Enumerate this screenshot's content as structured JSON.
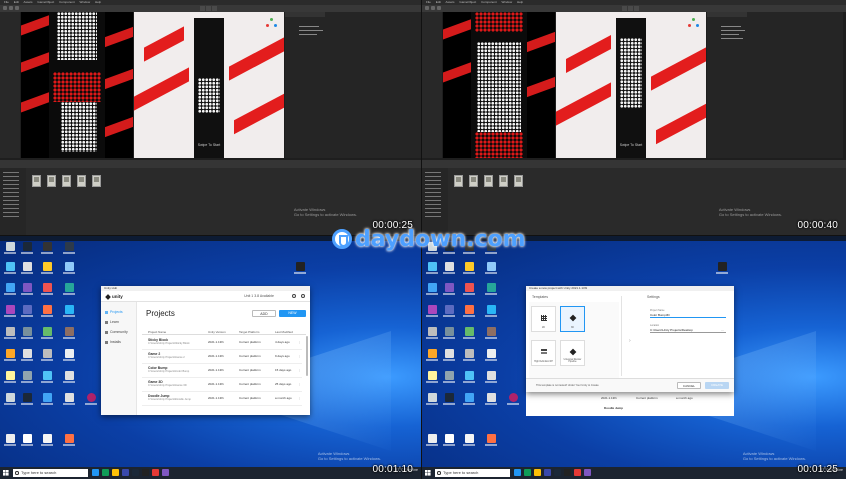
{
  "quadrants": {
    "top_left": {
      "timestamp": "00:00:25",
      "scene_text": "Swipe To Start",
      "menu": [
        "File",
        "Edit",
        "Assets",
        "GameObject",
        "Component",
        "Window",
        "Help"
      ],
      "activate": [
        "Activate Windows",
        "Go to Settings to activate Windows."
      ]
    },
    "top_right": {
      "timestamp": "00:00:40",
      "scene_text": "Swipe To Start",
      "menu": [
        "File",
        "Edit",
        "Assets",
        "GameObject",
        "Component",
        "Window",
        "Help"
      ],
      "activate": [
        "Activate Windows",
        "Go to Settings to activate Windows."
      ]
    },
    "bottom_left": {
      "timestamp": "00:01:10",
      "search_placeholder": "Type here to search",
      "tray_text": "17°C Esterline",
      "activate": [
        "Activate Windows",
        "Go to Settings to activate Windows."
      ],
      "hub": {
        "window_title": "Unity Hub",
        "logo": "unity",
        "license": "Unit 1 3.8 Available",
        "nav": [
          "Projects",
          "Learn",
          "Community",
          "Installs"
        ],
        "title": "Projects",
        "add_label": "ADD",
        "new_label": "NEW",
        "columns": [
          "Project Name",
          "Unity Version",
          "Target Platform",
          "Last Modified"
        ],
        "rows": [
          {
            "name": "Sticky Block",
            "path": "C:\\Users\\Unity Projects\\Sticky Block",
            "version": "2021.1.13f1",
            "platform": "Current platform",
            "modified": "4 days ago"
          },
          {
            "name": "Game 2",
            "path": "C:\\Users\\Unity Projects\\Game 2",
            "version": "2021.1.13f1",
            "platform": "Current platform",
            "modified": "9 days ago"
          },
          {
            "name": "Color Bump",
            "path": "C:\\Users\\Unity Projects\\Color Bump",
            "version": "2021.1.13f1",
            "platform": "Current platform",
            "modified": "15 days ago"
          },
          {
            "name": "Game 3D",
            "path": "C:\\Users\\Unity Projects\\Game 3D",
            "version": "2021.1.13f1",
            "platform": "Current platform",
            "modified": "25 days ago"
          },
          {
            "name": "Doodle Jump",
            "path": "C:\\Users\\Unity Projects\\Doodle Jump",
            "version": "2021.1.13f1",
            "platform": "Current platform",
            "modified": "a month ago"
          }
        ]
      }
    },
    "bottom_right": {
      "timestamp": "00:01:25",
      "search_placeholder": "Type here to search",
      "tray_text": "17°C Esterline",
      "activate": [
        "Activate Windows",
        "Go to Settings to activate Windows."
      ],
      "new_project": {
        "window_title": "Create a new project with Unity 2021.1.13f1",
        "templates_label": "Templates",
        "settings_label": "Settings",
        "tiles": [
          {
            "caption": "2D",
            "selected": false
          },
          {
            "caption": "3D",
            "selected": true
          },
          {
            "caption": "High Definition RP",
            "selected": false
          },
          {
            "caption": "Universal Render Pipeline",
            "selected": false
          }
        ],
        "project_name_label": "Project Name",
        "project_name_value": "Color Bump3D",
        "location_label": "Location",
        "location_value": "C:\\Users\\Unity Projects\\Desktop",
        "footnote": "This template is not tested! Under Your Unity to Create",
        "cancel_label": "CANCEL",
        "create_label": "CREATE",
        "behind_row": {
          "name": "Doodle Jump",
          "version": "2021.1.13f1",
          "platform": "Current platform",
          "modified": "a month ago"
        }
      }
    }
  },
  "center_watermark": "daydown.com",
  "colors": {
    "track_red": "#d41b1b",
    "accent_blue": "#2196f3",
    "desktop_blue": "#1663d4"
  }
}
